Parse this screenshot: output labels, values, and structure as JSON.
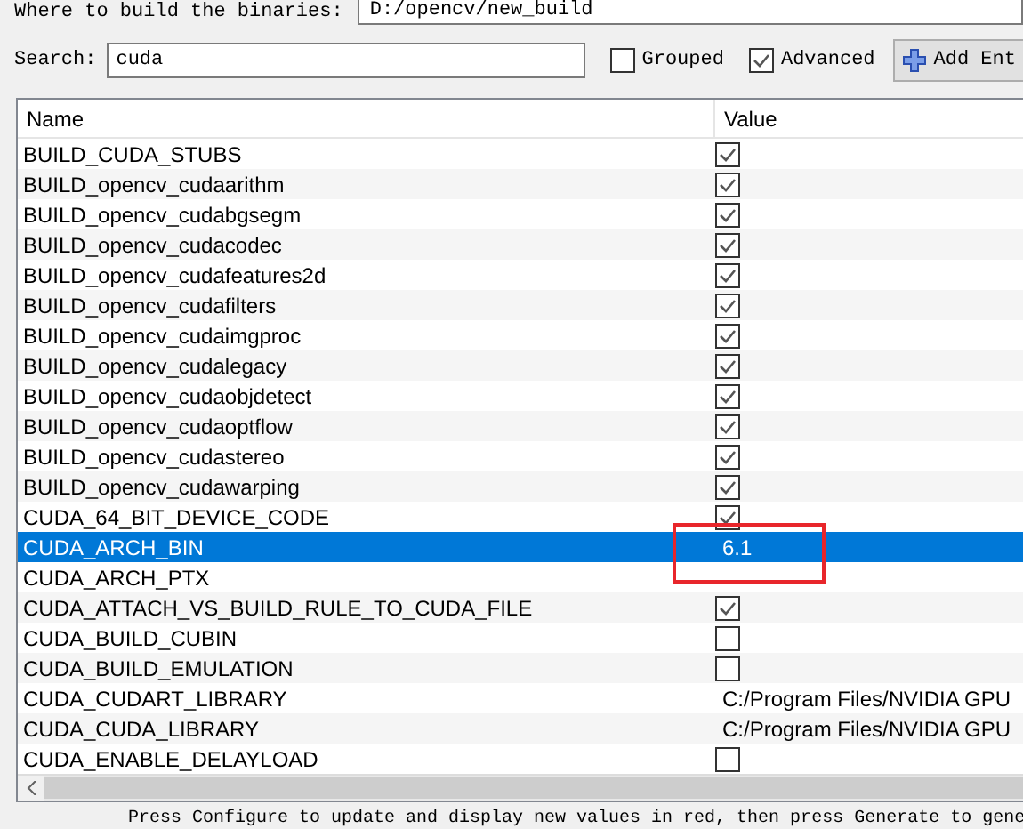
{
  "build_dir": {
    "label": "Where to build the binaries:",
    "value": "D:/opencv/new_build"
  },
  "search": {
    "label": "Search:",
    "value": "cuda"
  },
  "options": [
    {
      "label": "Grouped",
      "checked": false
    },
    {
      "label": "Advanced",
      "checked": true
    }
  ],
  "add_button": {
    "label": "Add Ent"
  },
  "table": {
    "columns": [
      "Name",
      "Value"
    ],
    "rows": [
      {
        "name": "BUILD_CUDA_STUBS",
        "kind": "bool",
        "checked": true,
        "selected": false
      },
      {
        "name": "BUILD_opencv_cudaarithm",
        "kind": "bool",
        "checked": true,
        "selected": false
      },
      {
        "name": "BUILD_opencv_cudabgsegm",
        "kind": "bool",
        "checked": true,
        "selected": false
      },
      {
        "name": "BUILD_opencv_cudacodec",
        "kind": "bool",
        "checked": true,
        "selected": false
      },
      {
        "name": "BUILD_opencv_cudafeatures2d",
        "kind": "bool",
        "checked": true,
        "selected": false
      },
      {
        "name": "BUILD_opencv_cudafilters",
        "kind": "bool",
        "checked": true,
        "selected": false
      },
      {
        "name": "BUILD_opencv_cudaimgproc",
        "kind": "bool",
        "checked": true,
        "selected": false
      },
      {
        "name": "BUILD_opencv_cudalegacy",
        "kind": "bool",
        "checked": true,
        "selected": false
      },
      {
        "name": "BUILD_opencv_cudaobjdetect",
        "kind": "bool",
        "checked": true,
        "selected": false
      },
      {
        "name": "BUILD_opencv_cudaoptflow",
        "kind": "bool",
        "checked": true,
        "selected": false
      },
      {
        "name": "BUILD_opencv_cudastereo",
        "kind": "bool",
        "checked": true,
        "selected": false
      },
      {
        "name": "BUILD_opencv_cudawarping",
        "kind": "bool",
        "checked": true,
        "selected": false
      },
      {
        "name": "CUDA_64_BIT_DEVICE_CODE",
        "kind": "bool",
        "checked": true,
        "selected": false
      },
      {
        "name": "CUDA_ARCH_BIN",
        "kind": "text",
        "value": "6.1",
        "selected": true,
        "highlighted": true
      },
      {
        "name": "CUDA_ARCH_PTX",
        "kind": "text",
        "selected": false
      },
      {
        "name": "CUDA_ATTACH_VS_BUILD_RULE_TO_CUDA_FILE",
        "kind": "bool",
        "checked": true,
        "selected": false
      },
      {
        "name": "CUDA_BUILD_CUBIN",
        "kind": "bool",
        "checked": false,
        "selected": false
      },
      {
        "name": "CUDA_BUILD_EMULATION",
        "kind": "bool",
        "checked": false,
        "selected": false
      },
      {
        "name": "CUDA_CUDART_LIBRARY",
        "kind": "text",
        "value": "C:/Program Files/NVIDIA GPU",
        "selected": false
      },
      {
        "name": "CUDA_CUDA_LIBRARY",
        "kind": "text",
        "value": "C:/Program Files/NVIDIA GPU",
        "selected": false
      },
      {
        "name": "CUDA_ENABLE_DELAYLOAD",
        "kind": "bool",
        "checked": false,
        "selected": false
      }
    ]
  },
  "status_bar": "Press Configure to update and display new values in red, then press Generate to gene"
}
